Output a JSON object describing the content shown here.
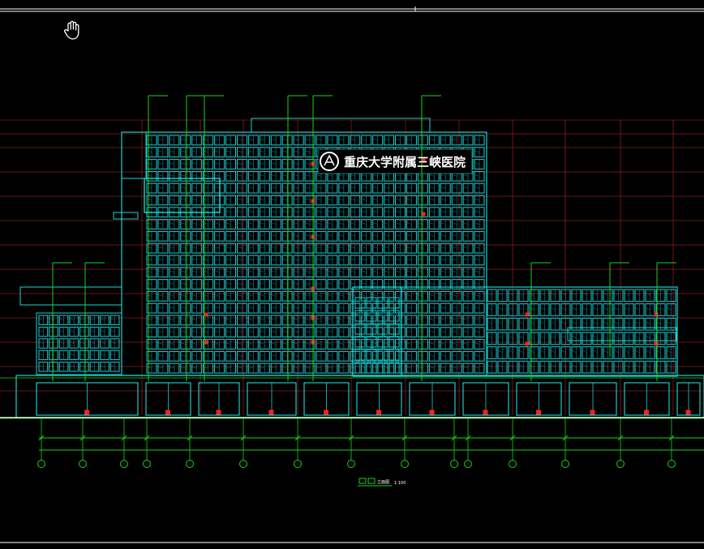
{
  "canvas": {
    "background": "#000000"
  },
  "tool": {
    "icon": "hand-pan-icon"
  },
  "colors": {
    "facade": "#19d3d3",
    "facade_bright": "#22f0f0",
    "facade_dim": "#0e8a9a",
    "grid": "#8b1a1a",
    "leader": "#1ad41a",
    "frame": "#ffffff",
    "accent": "#ff2020",
    "sign_text": "#ffffff"
  },
  "drawing": {
    "signage": "重庆大学附属三峡医院",
    "title": "立面图",
    "scale": "1:100"
  }
}
